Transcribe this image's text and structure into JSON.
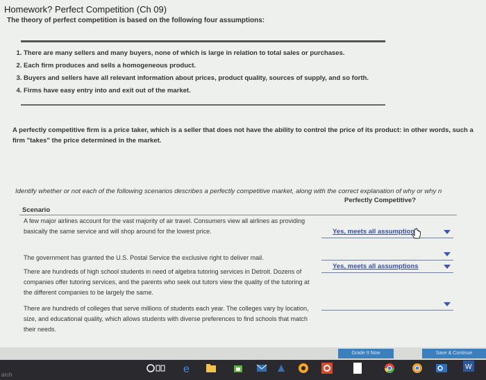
{
  "header": {
    "title": "Homework? Perfect Competition (Ch 09)",
    "subtitle": "The theory of perfect competition is based on the following four assumptions:"
  },
  "assumptions": [
    "There are many sellers and many buyers, none of which is large in relation to total sales or purchases.",
    "Each firm produces and sells a homogeneous product.",
    "Buyers and sellers have all relevant information about prices, product quality, sources of supply, and so forth.",
    "Firms have easy entry into and exit out of the market."
  ],
  "definition": "A perfectly competitive firm is a price taker, which is a seller that does not have the ability to control the price of its product: in other words, such a firm \"takes\" the price determined in the market.",
  "instruction": "Identify whether or not each of the following scenarios describes a perfectly competitive market, along with the correct explanation of why or why n",
  "table": {
    "col_scenario": "Scenario",
    "col_perfect": "Perfectly Competitive?",
    "rows": [
      {
        "scenario": "A few major airlines account for the vast majority of air travel. Consumers view all airlines as providing basically the same service and will shop around for the lowest price.",
        "selected": "Yes, meets all assumptions"
      },
      {
        "scenario": "The government has granted the U.S. Postal Service the exclusive right to deliver mail.",
        "selected": ""
      },
      {
        "scenario": "There are hundreds of high school students in need of algebra tutoring services in Detroit. Dozens of companies offer tutoring services, and the parents who seek out tutors view the quality of the tutoring at the different companies to be largely the same.",
        "selected": "Yes, meets all assumptions"
      },
      {
        "scenario": "There are hundreds of colleges that serve millions of students each year. The colleges vary by location, size, and educational quality, which allows students with diverse preferences to find schools that match their needs.",
        "selected": ""
      }
    ]
  },
  "buttons": {
    "grade": "Grade It Now",
    "save": "Save & Continue"
  },
  "taskbar": {
    "search": "arch"
  }
}
